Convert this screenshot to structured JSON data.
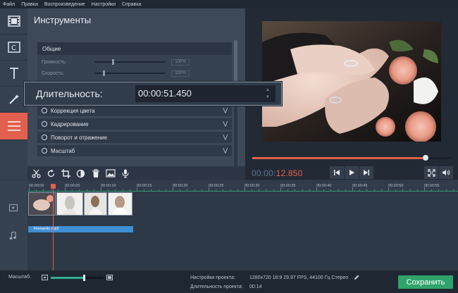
{
  "menu": [
    "Файл",
    "Правка",
    "Воспроизведение",
    "Настройки",
    "Справка"
  ],
  "sidebar": [
    {
      "icon": "film-icon"
    },
    {
      "icon": "clip-filter-icon"
    },
    {
      "icon": "text-icon"
    },
    {
      "icon": "magic-wand-icon"
    },
    {
      "icon": "menu-icon",
      "active": true
    }
  ],
  "tools": {
    "title": "Инструменты",
    "general": {
      "label": "Общие",
      "volume_label": "Громкость:",
      "volume_value": "100%",
      "volume_level": 0.25,
      "speed_label": "Скорость:",
      "speed_value": "100%",
      "speed_level": 0.12
    },
    "sections": [
      "Коррекция цвета",
      "Кадрирование",
      "Поворот и отражение",
      "Масштаб"
    ]
  },
  "duration_popup": {
    "label": "Длительность:",
    "value": "00:00:51.450"
  },
  "preview": {
    "seek_fraction": 0.87,
    "time_dim": "00:00:",
    "time_hi": "12.850"
  },
  "timeline": {
    "ticks": [
      "00:00:00",
      "00:00:05",
      "00:00:10",
      "00:00:15",
      "00:00:20",
      "00:00:25",
      "00:00:30",
      "00:00:35",
      "00:00:40",
      "00:00:45",
      "00:00:50",
      "00:00:55"
    ],
    "audio_clip": "Romantic.mp3"
  },
  "status": {
    "zoom_label": "Масштаб:",
    "zoom_fraction": 0.62,
    "settings_label": "Настройки проекта:",
    "settings_value": "1280x720 16:9 29.97 FPS, 44100 Гц Стерео",
    "duration_label": "Длительность проекта:",
    "duration_value": "00:14",
    "save_label": "Сохранить"
  },
  "colors": {
    "accent": "#e2604d",
    "save": "#2fa36b",
    "audio": "#3f8fd4"
  }
}
